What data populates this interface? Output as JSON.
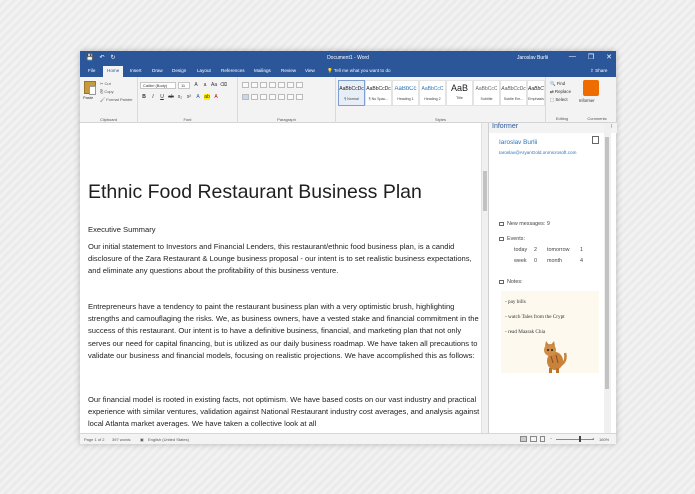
{
  "window": {
    "doc_title": "Document1 - Word",
    "user_name": "Jaroslav Burlii",
    "minimize": "—",
    "restore": "❐",
    "close": "✕"
  },
  "qat": {
    "save": "💾",
    "undo": "↶",
    "redo": "↻"
  },
  "tabs": [
    "File",
    "Home",
    "Insert",
    "Draw",
    "Design",
    "Layout",
    "References",
    "Mailings",
    "Review",
    "View"
  ],
  "tell_me": "Tell me what you want to do",
  "share": "Share",
  "ribbon": {
    "paste": "Paste",
    "cut": "Cut",
    "copy": "Copy",
    "format_painter": "Format Painter",
    "clipboard": "Clipboard",
    "font_name": "Calibri (Body)",
    "font_size": "11",
    "font": "Font",
    "paragraph": "Paragraph",
    "styles_label": "Styles",
    "styles": [
      {
        "preview": "AaBbCcDc",
        "name": "¶ Normal"
      },
      {
        "preview": "AaBbCcDc",
        "name": "¶ No Spac..."
      },
      {
        "preview": "AaBbCc",
        "name": "Heading 1"
      },
      {
        "preview": "AaBbCcC",
        "name": "Heading 2"
      },
      {
        "preview": "AaB",
        "name": "Title"
      },
      {
        "preview": "AaBbCcC",
        "name": "Subtitle"
      },
      {
        "preview": "AaBbCcDc",
        "name": "Subtle Em..."
      },
      {
        "preview": "AaBbCcDc",
        "name": "Emphasis"
      }
    ],
    "find": "Find",
    "replace": "Replace",
    "select": "Select",
    "editing": "Editing",
    "informer_btn": "Informer",
    "comments": "Comments"
  },
  "document": {
    "title": "Ethnic Food Restaurant Business Plan",
    "section": "Executive Summary",
    "p1": "Our initial statement to Investors and Financial Lenders, this restaurant/ethnic food business plan, is a candid disclosure of the Zara Restaurant & Lounge business proposal - our intent is to set realistic business expectations, and eliminate any questions about the profitability of this business venture.",
    "p2": "Entrepreneurs have a tendency to paint the restaurant business plan with a very optimistic brush, highlighting strengths and camouflaging the risks. We, as business owners, have a vested stake and financial commitment in the success of this restaurant. Our intent is to have a definitive business, financial, and marketing plan that not only serves our need for capital financing, but is utilized as our daily business roadmap. We have taken all precautions to validate our business and financial models, focusing on realistic projections. We have accomplished this as follows:",
    "p3": "Our financial model is rooted in existing facts, not optimism. We have based costs on our vast industry and practical experience with similar ventures, validation against National Restaurant industry cost averages, and analysis against local Atlanta market averages. We have taken a collective look at all"
  },
  "informer": {
    "title": "Informer",
    "user": "Iaroslav Burlii",
    "email": "Iaroslav@AryanGold.onmicrosoft.com",
    "new_messages": "New messages: 9",
    "events_label": "Events:",
    "events": [
      {
        "k1": "today",
        "v1": "2",
        "k2": "tomorrow",
        "v2": "1"
      },
      {
        "k1": "week",
        "v1": "0",
        "k2": "month",
        "v2": "4"
      }
    ],
    "notes_label": "Notes:",
    "notes": [
      "- pay bills",
      "- watch Tales from the Crypt",
      "- read Maarak Chia"
    ]
  },
  "status": {
    "page": "Page 1 of 2",
    "words": "397 words",
    "language": "English (United States)",
    "zoom": "160%"
  },
  "colors": {
    "accent": "#2b579a",
    "informer_orange": "#ef6c00",
    "notes_bg": "#fdf9ee"
  }
}
